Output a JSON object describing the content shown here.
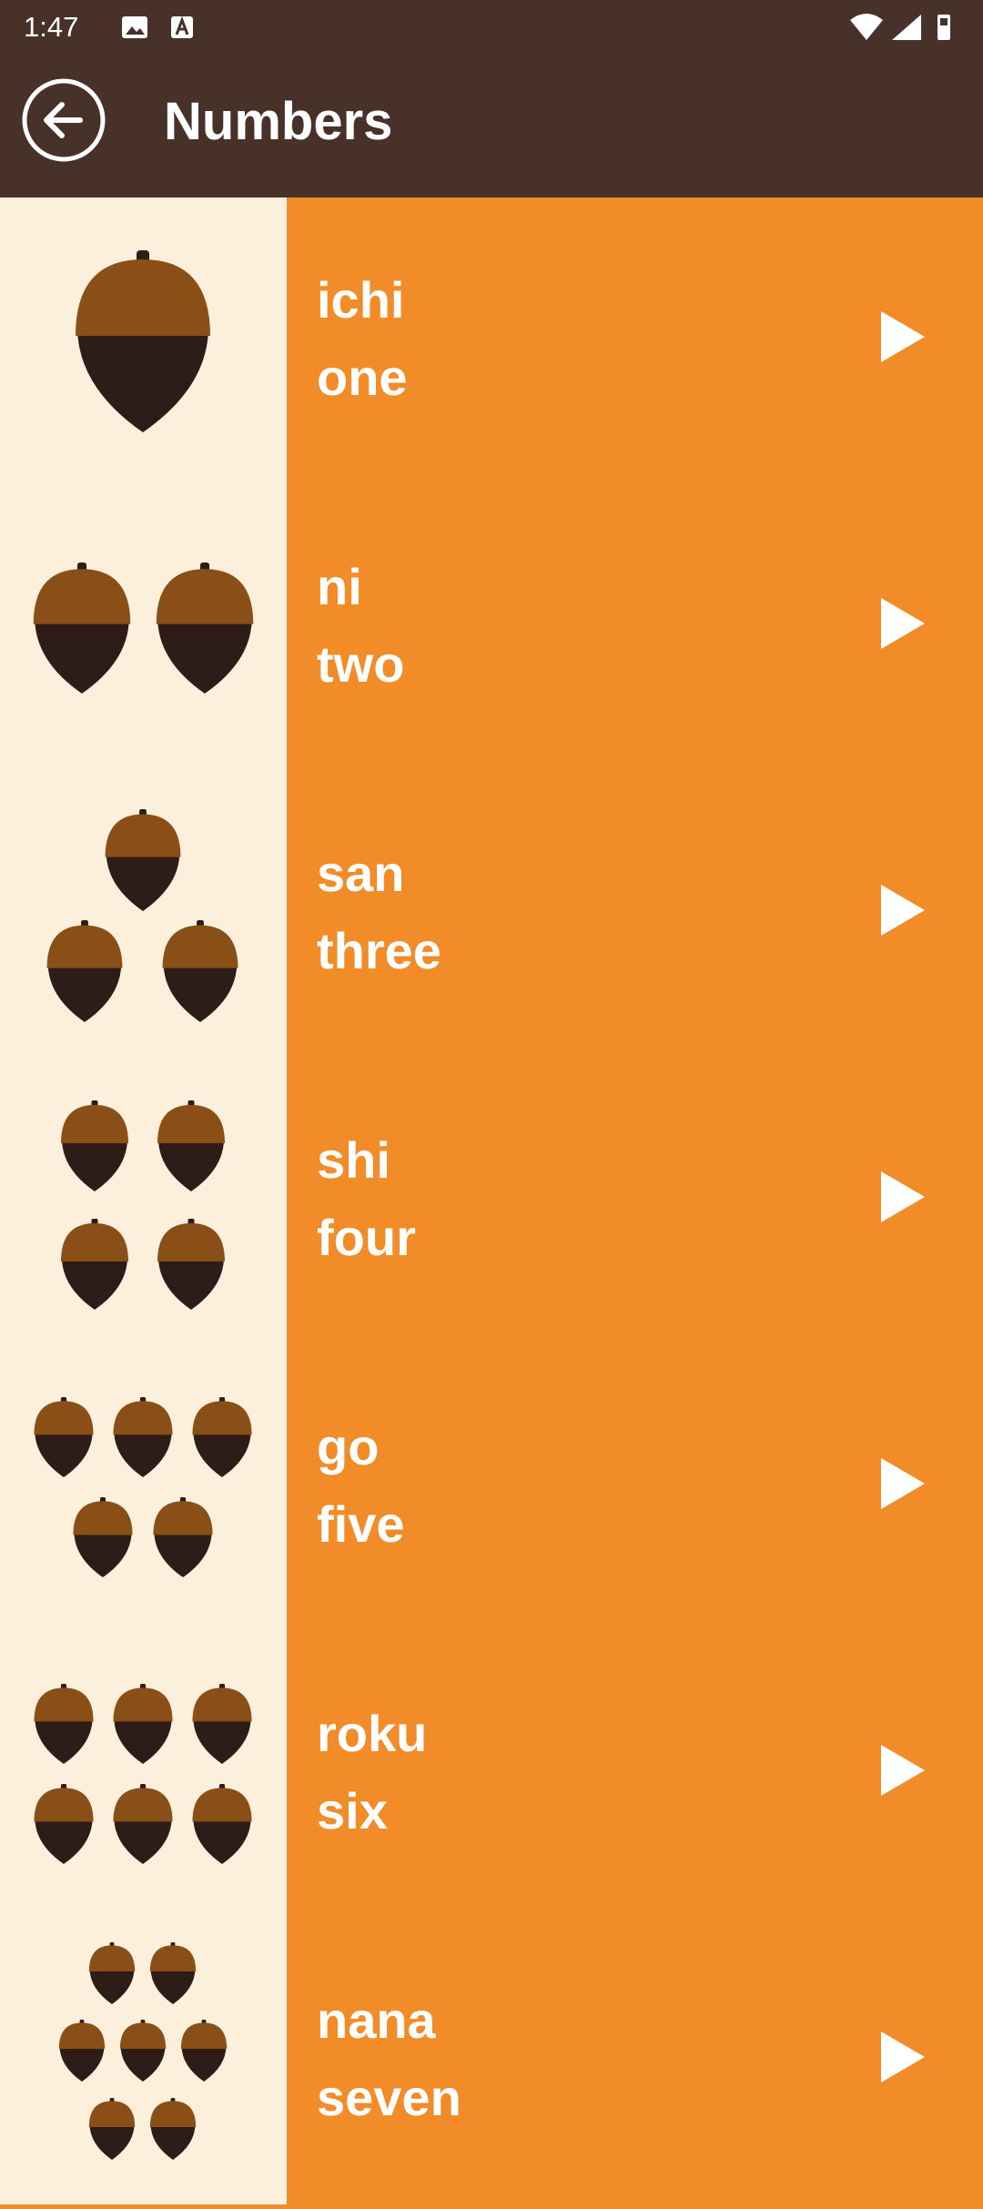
{
  "status_bar": {
    "time": "1:47"
  },
  "app_bar": {
    "title": "Numbers"
  },
  "colors": {
    "app_bar": "#473128",
    "item_bg": "#f28c28",
    "image_bg": "#fcf0dd",
    "acorn_cap": "#8a4f16",
    "acorn_body": "#2e1c18"
  },
  "numbers": [
    {
      "jp": "ichi",
      "en": "one",
      "count": 1
    },
    {
      "jp": "ni",
      "en": "two",
      "count": 2
    },
    {
      "jp": "san",
      "en": "three",
      "count": 3
    },
    {
      "jp": "shi",
      "en": "four",
      "count": 4
    },
    {
      "jp": "go",
      "en": "five",
      "count": 5
    },
    {
      "jp": "roku",
      "en": "six",
      "count": 6
    },
    {
      "jp": "nana",
      "en": "seven",
      "count": 7
    }
  ]
}
